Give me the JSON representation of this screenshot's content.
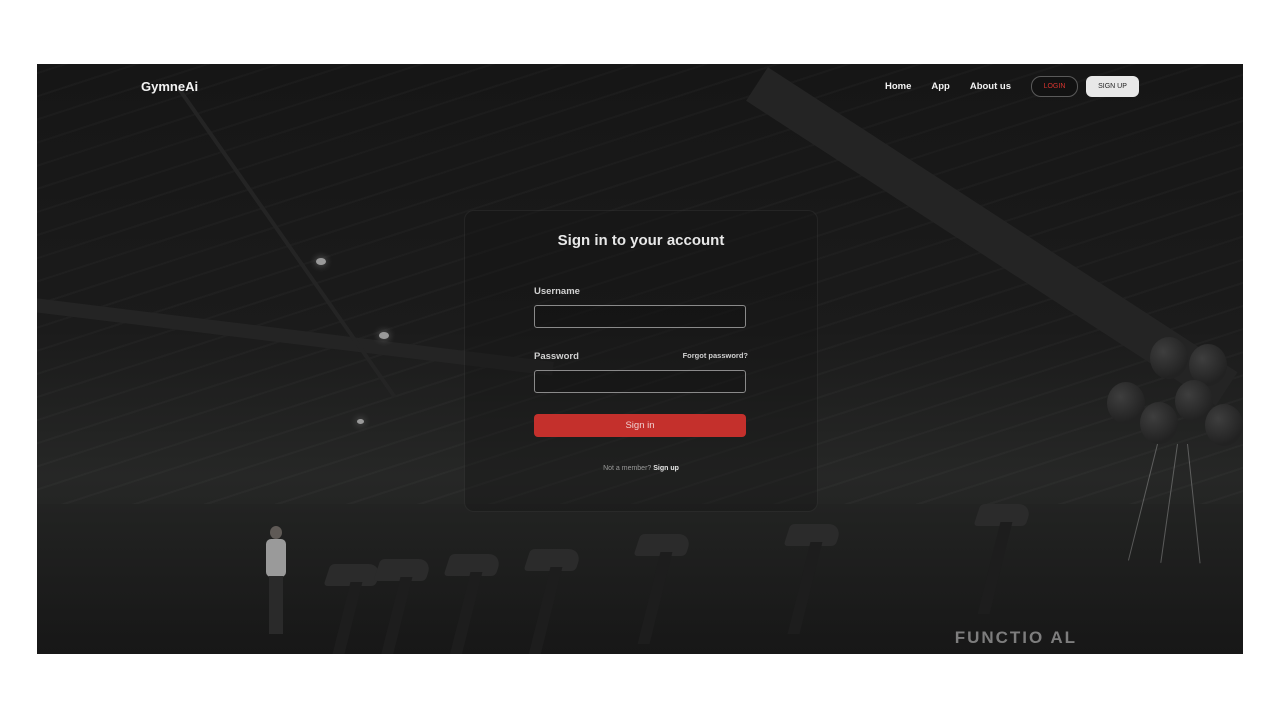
{
  "nav": {
    "logo": "GymneAi",
    "links": [
      "Home",
      "App",
      "About us"
    ],
    "login_label": "LOGIN",
    "signup_label": "SIGN UP"
  },
  "login_card": {
    "title": "Sign in to your account",
    "username_label": "Username",
    "username_value": "",
    "password_label": "Password",
    "password_value": "",
    "forgot_password": "Forgot password?",
    "submit_label": "Sign in",
    "footer_text": "Not a member?",
    "footer_link": "Sign up"
  },
  "background": {
    "wall_text": "FUNCTIO AL"
  },
  "colors": {
    "accent": "#c4302c",
    "login_text": "#d6342f",
    "background": "#141414"
  }
}
